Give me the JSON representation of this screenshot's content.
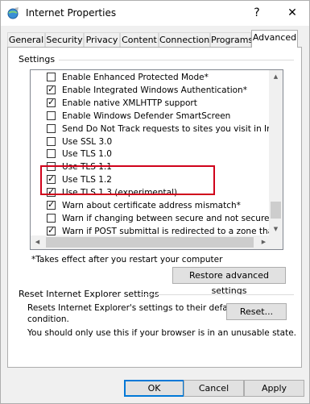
{
  "window": {
    "title": "Internet Properties",
    "help_glyph": "?",
    "close_glyph": "✕"
  },
  "tabs": [
    "General",
    "Security",
    "Privacy",
    "Content",
    "Connections",
    "Programs",
    "Advanced"
  ],
  "settings": {
    "group_label": "Settings",
    "items": [
      {
        "label": "Enable Enhanced Protected Mode*",
        "checked": false
      },
      {
        "label": "Enable Integrated Windows Authentication*",
        "checked": true
      },
      {
        "label": "Enable native XMLHTTP support",
        "checked": true
      },
      {
        "label": "Enable Windows Defender SmartScreen",
        "checked": false
      },
      {
        "label": "Send Do Not Track requests to sites you visit in Internet E",
        "checked": false
      },
      {
        "label": "Use SSL 3.0",
        "checked": false
      },
      {
        "label": "Use TLS 1.0",
        "checked": false
      },
      {
        "label": "Use TLS 1.1",
        "checked": false
      },
      {
        "label": "Use TLS 1.2",
        "checked": true
      },
      {
        "label": "Use TLS 1.3 (experimental)",
        "checked": true
      },
      {
        "label": "Warn about certificate address mismatch*",
        "checked": true
      },
      {
        "label": "Warn if changing between secure and not secure mode",
        "checked": false
      },
      {
        "label": "Warn if POST submittal is redirected to a zone that does n",
        "checked": true
      }
    ],
    "note": "*Takes effect after you restart your computer",
    "restore_button": "Restore advanced settings"
  },
  "reset": {
    "group_label": "Reset Internet Explorer settings",
    "description_line1": "Resets Internet Explorer's settings to their default",
    "description_line2": "condition.",
    "reset_button": "Reset...",
    "warning": "You should only use this if your browser is in an unusable state."
  },
  "footer": {
    "ok": "OK",
    "cancel": "Cancel",
    "apply": "Apply"
  },
  "colors": {
    "highlight_border": "#d0021b",
    "accent": "#0078d7"
  }
}
